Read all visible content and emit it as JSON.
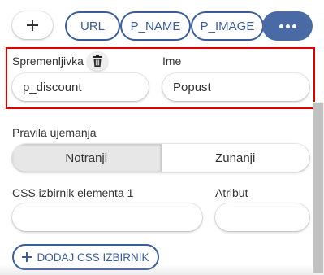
{
  "chips": {
    "add_label": "+",
    "items": [
      "URL",
      "P_NAME",
      "P_IMAGE"
    ],
    "more_icon": "more-horizontal-icon"
  },
  "variable_group": {
    "variable_label": "Spremenljivka",
    "variable_value": "p_discount",
    "name_label": "Ime",
    "name_value": "Popust",
    "delete_icon": "trash-icon",
    "highlight_color": "#e00000"
  },
  "matching_rules": {
    "label": "Pravila ujemanja",
    "options": [
      "Notranji",
      "Zunanji"
    ],
    "selected": "Notranji"
  },
  "css_selector": {
    "label": "CSS izbirnik elementa 1",
    "value": "",
    "attribute_label": "Atribut",
    "attribute_value": ""
  },
  "add_css_button": {
    "label": "DODAJ CSS IZBIRNIK"
  },
  "colors": {
    "accent": "#3b5e9a",
    "accent_fill": "#4a6aa6",
    "highlight": "#e00000",
    "segment_active": "#e7e7e7"
  }
}
